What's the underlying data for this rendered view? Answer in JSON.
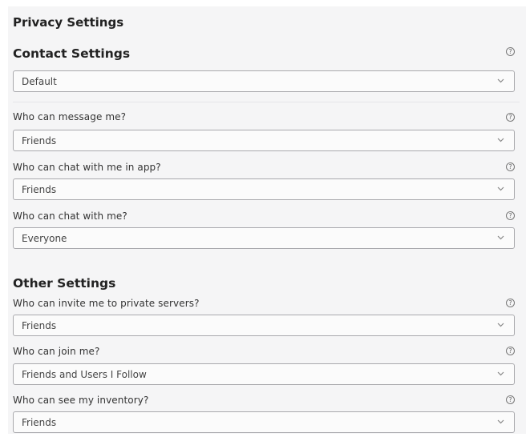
{
  "page_title": "Privacy Settings",
  "contact": {
    "title": "Contact Settings",
    "preset_value": "Default",
    "fields": [
      {
        "label": "Who can message me?",
        "value": "Friends"
      },
      {
        "label": "Who can chat with me in app?",
        "value": "Friends"
      },
      {
        "label": "Who can chat with me?",
        "value": "Everyone"
      }
    ]
  },
  "other": {
    "title": "Other Settings",
    "fields": [
      {
        "label": "Who can invite me to private servers?",
        "value": "Friends"
      },
      {
        "label": "Who can join me?",
        "value": "Friends and Users I Follow"
      },
      {
        "label": "Who can see my inventory?",
        "value": "Friends"
      }
    ]
  },
  "icons": {
    "help": "help-circle-icon",
    "dropdown": "chevron-down-icon"
  }
}
